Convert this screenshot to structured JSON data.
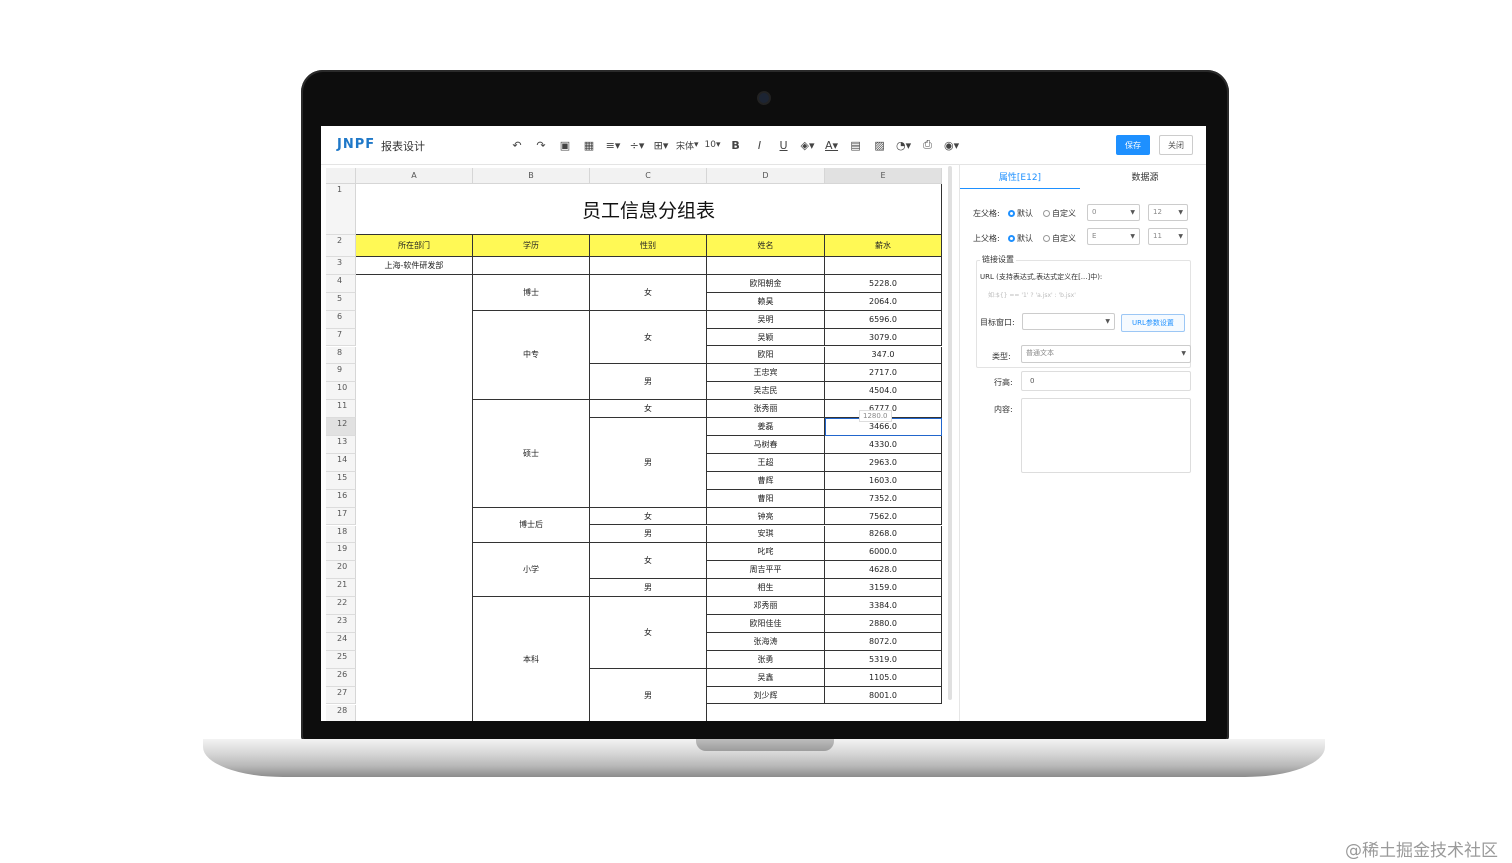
{
  "app": {
    "logo": "JNPF",
    "title": "报表设计",
    "save_label": "保存",
    "close_label": "关闭"
  },
  "toolbar": {
    "font": "宋体",
    "size": "10",
    "icons": [
      "undo-icon",
      "redo-icon",
      "format-painter-icon",
      "border-icon",
      "align-icon",
      "valign-icon",
      "merge-icon",
      "font-select",
      "font-size-select",
      "bold-icon",
      "italic-icon",
      "underline-icon",
      "fill-color-icon",
      "font-color-icon",
      "cell-icon",
      "image-icon",
      "chart-icon",
      "print-icon",
      "eye-icon"
    ]
  },
  "sheet": {
    "columns": [
      "A",
      "B",
      "C",
      "D",
      "E"
    ],
    "title": "员工信息分组表",
    "headers": [
      "所在部门",
      "学历",
      "性别",
      "姓名",
      "薪水"
    ],
    "department": "上海-软件研发部",
    "row_numbers": [
      "1",
      "2",
      "3",
      "4",
      "5",
      "6",
      "7",
      "8",
      "9",
      "10",
      "11",
      "12",
      "13",
      "14",
      "15",
      "16",
      "17",
      "18",
      "19",
      "20",
      "21",
      "22",
      "23",
      "24",
      "25",
      "26",
      "27",
      "28"
    ],
    "education": [
      "博士",
      "中专",
      "硕士",
      "博士后",
      "小学",
      "本科"
    ],
    "genders": [
      "女",
      "女",
      "男",
      "女",
      "男",
      "女",
      "男",
      "女",
      "男",
      "女",
      "男"
    ],
    "rows": [
      {
        "name": "欧阳朝金",
        "salary": "5228.0"
      },
      {
        "name": "赖昊",
        "salary": "2064.0"
      },
      {
        "name": "吴明",
        "salary": "6596.0"
      },
      {
        "name": "吴颖",
        "salary": "3079.0"
      },
      {
        "name": "欧阳",
        "salary": "347.0"
      },
      {
        "name": "王忠宾",
        "salary": "2717.0"
      },
      {
        "name": "吴志民",
        "salary": "4504.0"
      },
      {
        "name": "张秀丽",
        "salary": "6777.0"
      },
      {
        "name": "姜磊",
        "salary": "3466.0"
      },
      {
        "name": "马树春",
        "salary": "4330.0"
      },
      {
        "name": "王超",
        "salary": "2963.0"
      },
      {
        "name": "曹辉",
        "salary": "1603.0"
      },
      {
        "name": "曹阳",
        "salary": "7352.0"
      },
      {
        "name": "钟亮",
        "salary": "7562.0"
      },
      {
        "name": "安琪",
        "salary": "8268.0"
      },
      {
        "name": "叱咤",
        "salary": "6000.0"
      },
      {
        "name": "周吉平平",
        "salary": "4628.0"
      },
      {
        "name": "相生",
        "salary": "3159.0"
      },
      {
        "name": "邓秀丽",
        "salary": "3384.0"
      },
      {
        "name": "欧阳佳佳",
        "salary": "2880.0"
      },
      {
        "name": "张海涛",
        "salary": "8072.0"
      },
      {
        "name": "张勇",
        "salary": "5319.0"
      },
      {
        "name": "吴鑫",
        "salary": "1105.0"
      },
      {
        "name": "刘少辉",
        "salary": "8001.0"
      }
    ],
    "tooltip": "1280.0"
  },
  "panel": {
    "tab_properties": "属性[E12]",
    "tab_datasource": "数据源",
    "left_parent_label": "左父格:",
    "top_parent_label": "上父格:",
    "default_label": "默认",
    "custom_label": "自定义",
    "left_parent_col": "0",
    "left_parent_num": "12",
    "top_parent_col": "E",
    "top_parent_num": "11",
    "link_group_title": "链接设置",
    "url_hint": "URL (支持表达式,表达式定义在[...]中):",
    "url_example": "如:${} == '1' ? 'a.jsx' : 'b.jsx'",
    "target_label": "目标窗口:",
    "url_button": "URL参数设置",
    "type_label": "类型:",
    "type_value": "普通文本",
    "rowspan_label": "行高:",
    "rowspan_value": "0",
    "content_label": "内容:"
  },
  "watermark": "@稀土掘金技术社区"
}
